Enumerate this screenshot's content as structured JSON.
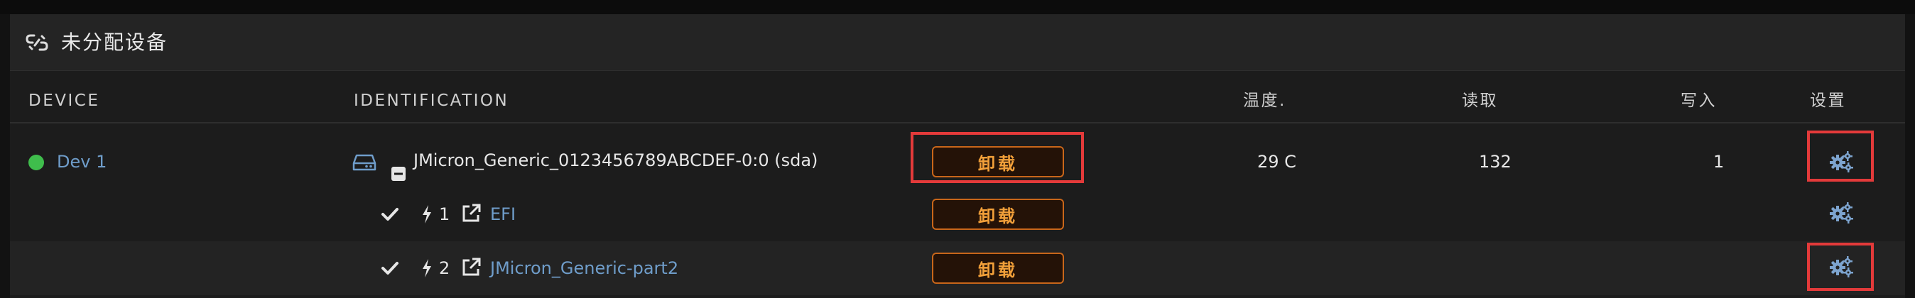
{
  "panel": {
    "title": "未分配设备",
    "title_icon": "chain-broken-icon"
  },
  "columns": {
    "device": "DEVICE",
    "identification": "IDENTIFICATION",
    "temp": "温度.",
    "reads": "读取",
    "writes": "写入",
    "settings": "设置"
  },
  "disk": {
    "status_color": "#3fbd4c",
    "device_name": "Dev 1",
    "identification": "JMicron_Generic_0123456789ABCDEF-0:0 (sda)",
    "unmount_label": "卸载",
    "temperature": "29 C",
    "reads": "132",
    "writes": "1",
    "settings_icon": "gears-icon"
  },
  "partitions": [
    {
      "index": "1",
      "label": "EFI",
      "unmount_label": "卸载",
      "settings_icon": "gears-icon"
    },
    {
      "index": "2",
      "label": "JMicron_Generic-part2",
      "unmount_label": "卸载",
      "settings_icon": "gears-icon"
    }
  ],
  "colors": {
    "accent_orange": "#f2a03a",
    "link_blue": "#6f9dca",
    "highlight_red": "#e33a3a",
    "status_green": "#3fbd4c"
  }
}
